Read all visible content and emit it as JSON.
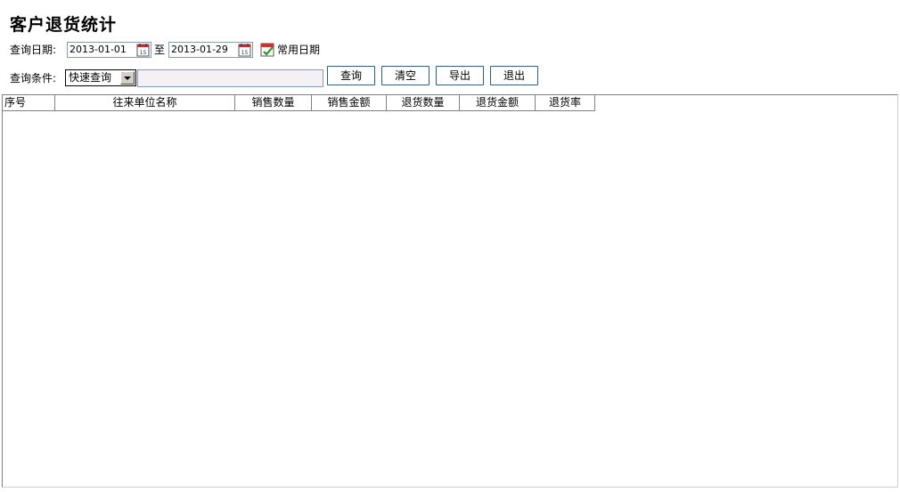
{
  "page": {
    "title": "客户退货统计"
  },
  "filters": {
    "date_label": "查询日期:",
    "start_date": "2013-01-01",
    "to_label": "至",
    "end_date": "2013-01-29",
    "common_date_label": "常用日期",
    "condition_label": "查询条件:",
    "condition_selected": "快速查询",
    "search_value": ""
  },
  "buttons": {
    "query": "查询",
    "clear": "清空",
    "export": "导出",
    "exit": "退出"
  },
  "table": {
    "columns": [
      "序号",
      "往来单位名称",
      "销售数量",
      "销售金额",
      "退货数量",
      "退货金额",
      "退货率"
    ],
    "rows": []
  },
  "icons": {
    "calendar": "calendar-icon",
    "common_date": "calendar-check-icon",
    "dropdown": "chevron-down-icon"
  }
}
